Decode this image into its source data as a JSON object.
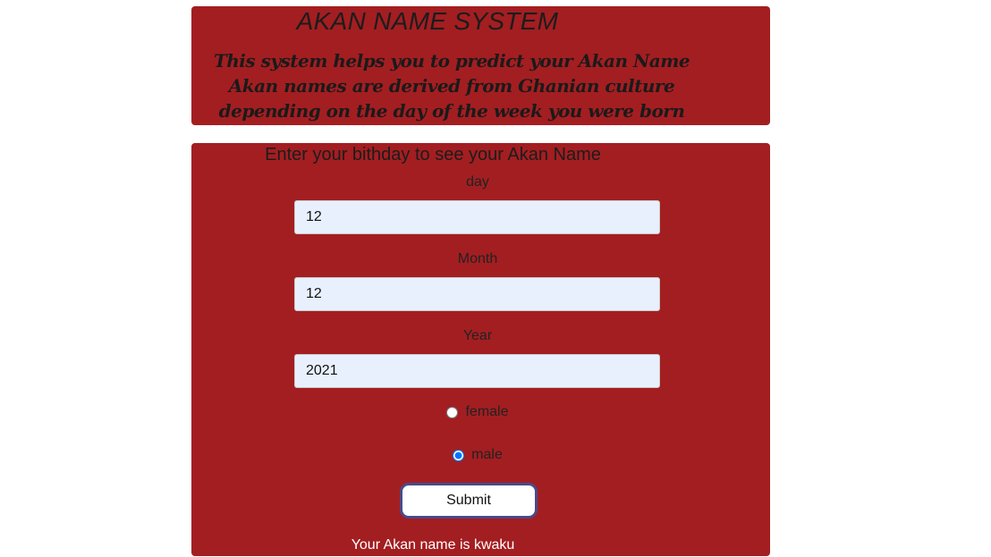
{
  "header": {
    "title": "AKAN NAME SYSTEM",
    "tagline_lines": [
      "This system helps you to predict your Akan Name",
      "Akan names are derived from Ghanian culture",
      "depending on the day of the week you were born"
    ]
  },
  "form": {
    "heading": "Enter your bithday to see your Akan Name",
    "day": {
      "label": "day",
      "value": "12"
    },
    "month": {
      "label": "Month",
      "value": "12"
    },
    "year": {
      "label": "Year",
      "value": "2021"
    },
    "gender": {
      "options": [
        {
          "label": "female",
          "checked": false
        },
        {
          "label": "male",
          "checked": true
        }
      ]
    },
    "submit_label": "Submit",
    "result": "Your Akan name is kwaku"
  },
  "colors": {
    "panel": "#a31e21",
    "input_bg": "#e8f0fe",
    "result_text": "#ffffff"
  }
}
